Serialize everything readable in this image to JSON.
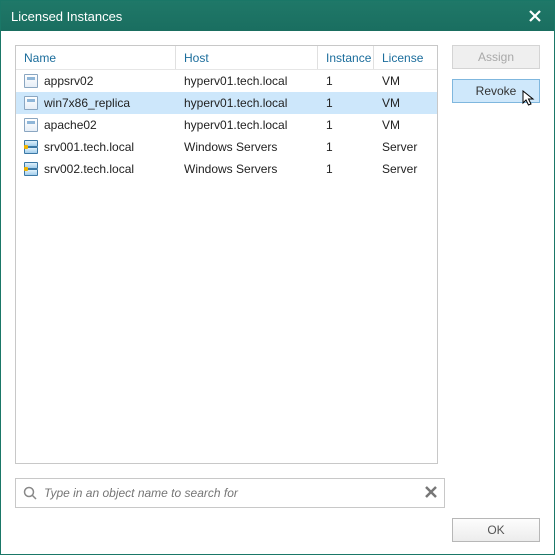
{
  "window": {
    "title": "Licensed Instances"
  },
  "columns": {
    "name": "Name",
    "host": "Host",
    "instance": "Instance",
    "license": "License"
  },
  "rows": [
    {
      "name": "appsrv02",
      "host": "hyperv01.tech.local",
      "instance": "1",
      "license": "VM",
      "icon": "vm",
      "selected": false
    },
    {
      "name": "win7x86_replica",
      "host": "hyperv01.tech.local",
      "instance": "1",
      "license": "VM",
      "icon": "vm",
      "selected": true
    },
    {
      "name": "apache02",
      "host": "hyperv01.tech.local",
      "instance": "1",
      "license": "VM",
      "icon": "vm",
      "selected": false
    },
    {
      "name": "srv001.tech.local",
      "host": "Windows Servers",
      "instance": "1",
      "license": "Server",
      "icon": "server",
      "selected": false
    },
    {
      "name": "srv002.tech.local",
      "host": "Windows Servers",
      "instance": "1",
      "license": "Server",
      "icon": "server",
      "selected": false
    }
  ],
  "buttons": {
    "assign": "Assign",
    "revoke": "Revoke",
    "ok": "OK"
  },
  "search": {
    "placeholder": "Type in an object name to search for"
  },
  "colors": {
    "accent": "#1a7767",
    "selection": "#cde7fb",
    "link": "#1b6d9c"
  }
}
